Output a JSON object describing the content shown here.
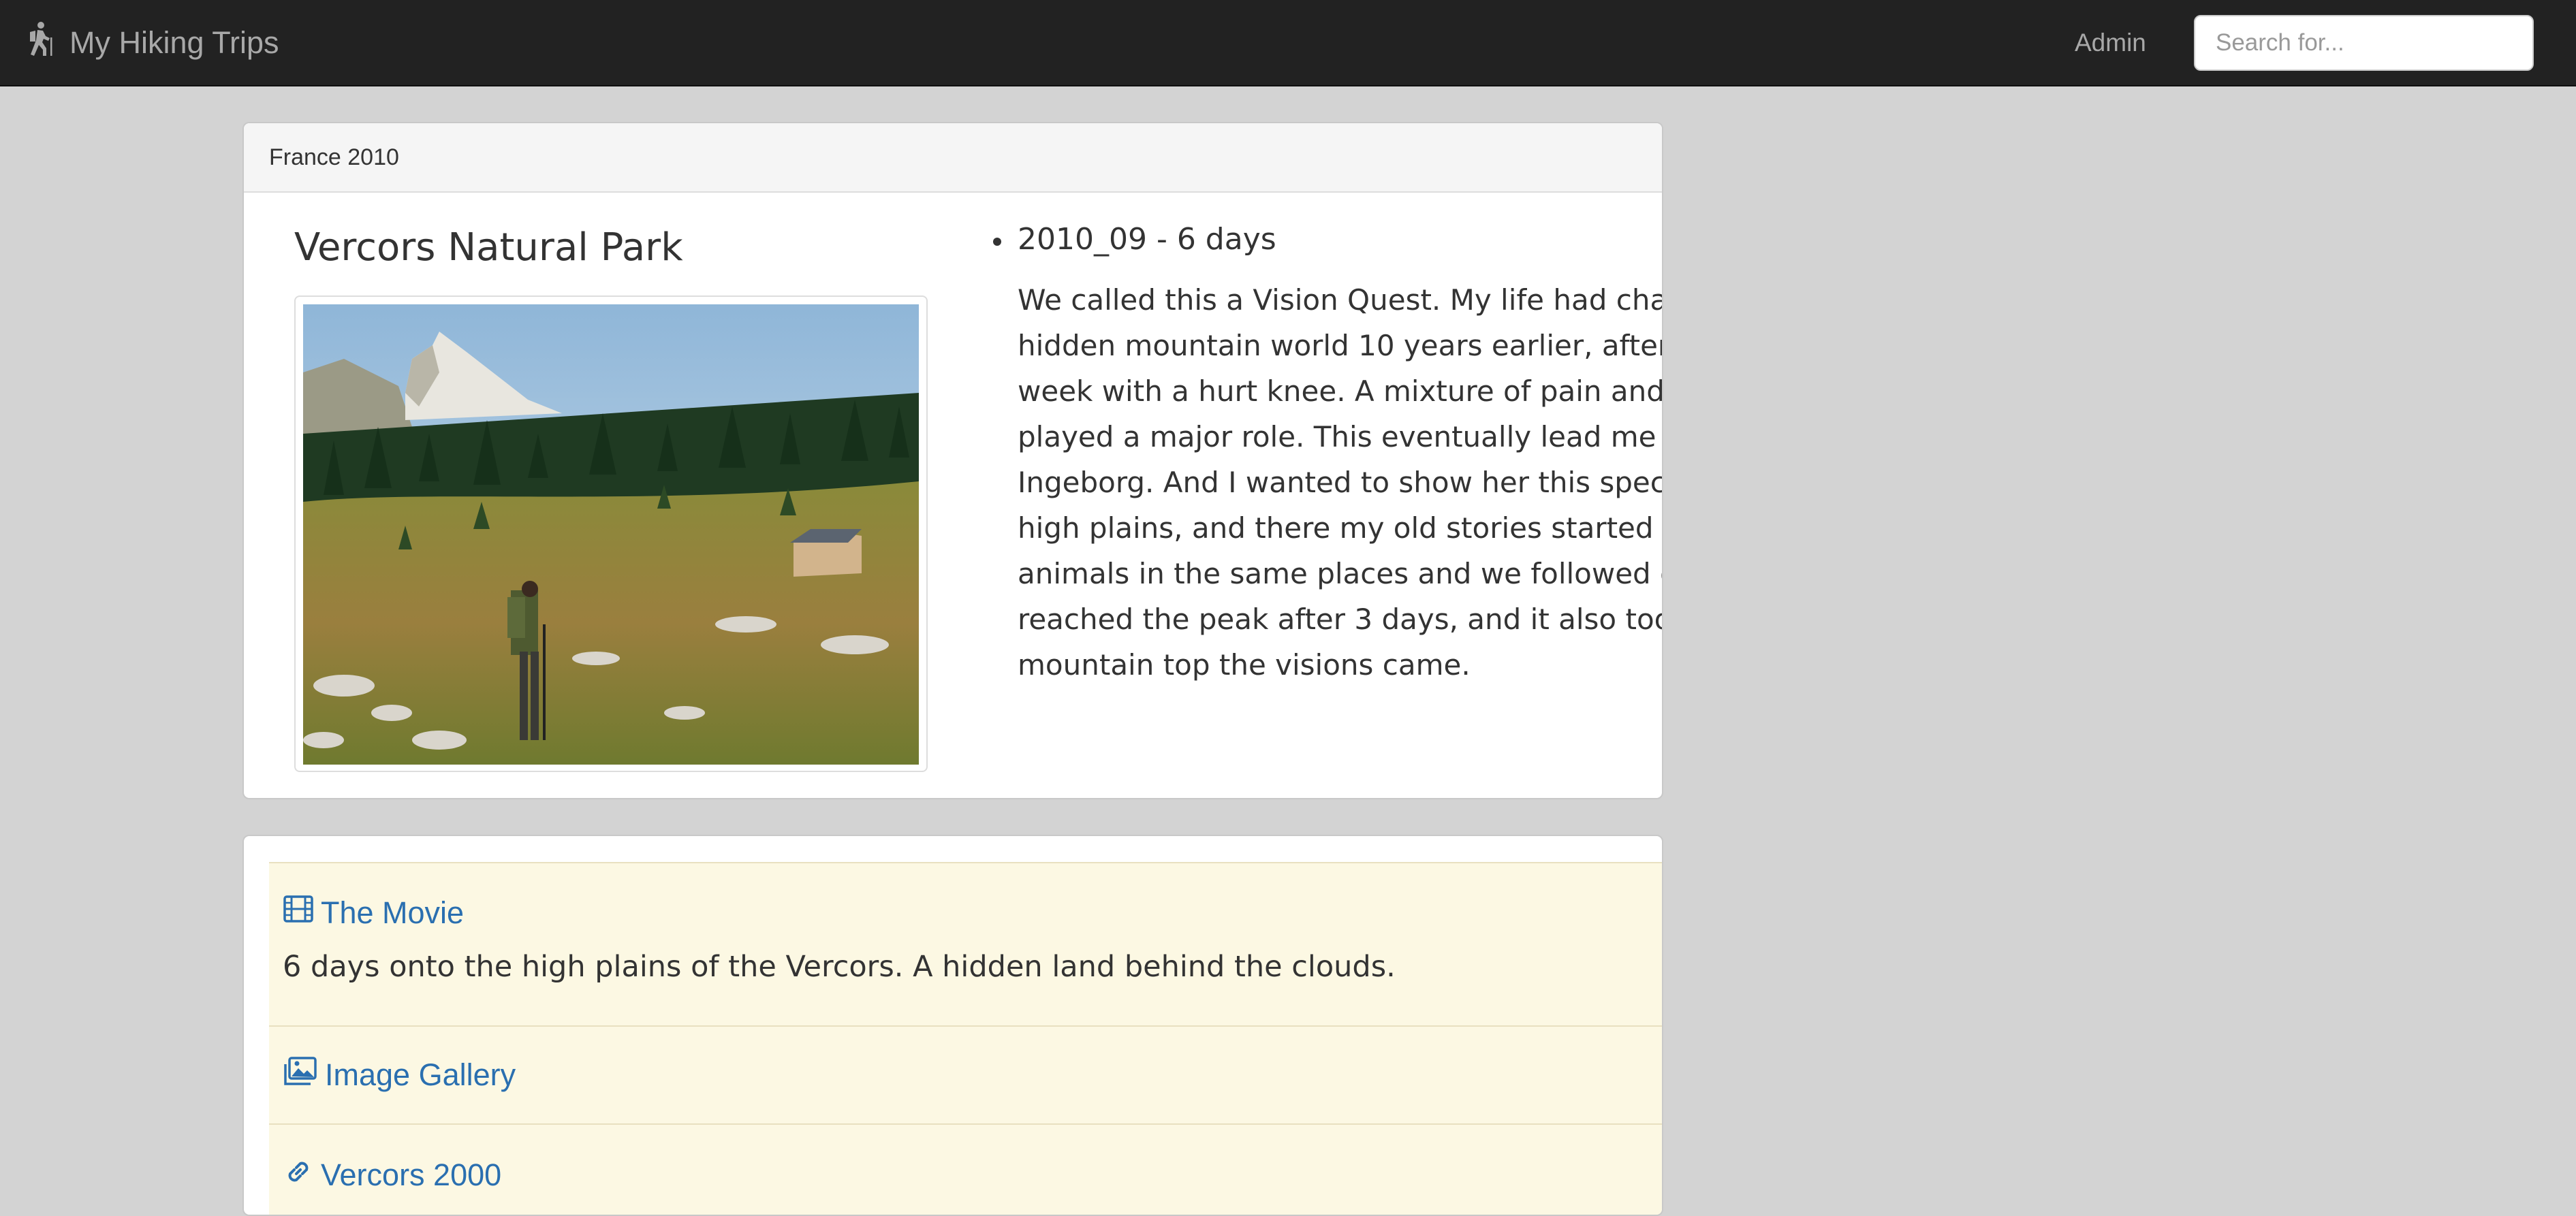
{
  "navbar": {
    "brand_label": "My Hiking Trips",
    "brand_icon": "hiker-icon",
    "admin_label": "Admin",
    "search_placeholder": "Search for..."
  },
  "trip": {
    "heading": "France 2010",
    "title": "Vercors Natural Park",
    "entries": [
      {
        "date": "2010_09 - 6 days",
        "text": "We called this a Vision Quest. My life had changed by 'peak experiences' in this hidden mountain world 10 years earlier, after I was forced to continue a hike for a week with a hurt knee. A mixture of pain and extacy, in which nature and wildlife played a major role. This eventually lead me to a lifestyle called 'druidry', where I met Ingeborg. And I wanted to show her this special place. It was a hard hike up to the high plains, and there my old stories started to repeat themselves. I met the same animals in the same places and we followed our trail to a specific mountain top. We reached the peak after 3 days, and it also took us 3 days to return. And on that mountain top the visions came."
      }
    ]
  },
  "links": [
    {
      "icon": "film-icon",
      "label": "The Movie",
      "description": "6 days onto the high plains of the Vercors. A hidden land behind the clouds."
    },
    {
      "icon": "image-gallery-icon",
      "label": "Image Gallery"
    },
    {
      "icon": "link-icon",
      "label": "Vercors 2000"
    }
  ],
  "colors": {
    "navbar_bg": "#222222",
    "page_bg": "#d3d3d3",
    "link": "#2a6fb0",
    "link_row_bg": "#fcf8e3"
  }
}
